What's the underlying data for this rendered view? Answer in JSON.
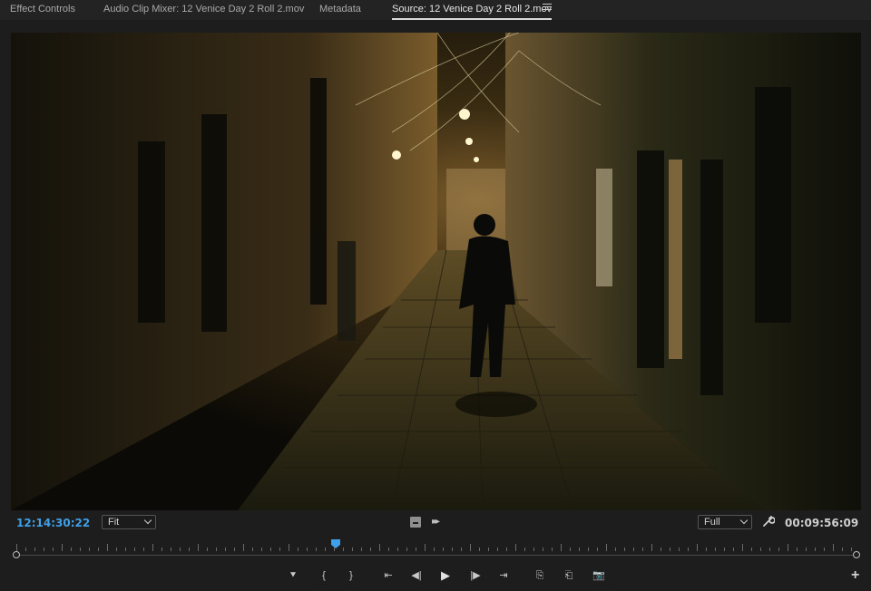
{
  "tabs": [
    {
      "label": "Effect Controls",
      "active": false
    },
    {
      "label": "Audio Clip Mixer: 12 Venice Day 2 Roll 2.mov",
      "active": false
    },
    {
      "label": "Metadata",
      "active": false
    },
    {
      "label": "Source: 12 Venice Day 2 Roll 2.mov",
      "active": true
    }
  ],
  "viewer": {
    "current_timecode": "12:14:30:22",
    "duration_timecode": "00:09:56:09",
    "zoom_select": "Fit",
    "resolution_select": "Full",
    "playhead_fraction": 0.38
  },
  "icons": {
    "panel_menu": "hamburger-menu-icon",
    "settings": "settings-icon",
    "wrench": "wrench-icon",
    "add": "plus-icon"
  },
  "transport": [
    {
      "name": "add-marker-button",
      "glyph": "⯆"
    },
    {
      "name": "mark-in-button",
      "glyph": "{"
    },
    {
      "name": "mark-out-button",
      "glyph": "}"
    },
    {
      "name": "go-to-in-button",
      "glyph": "⇤"
    },
    {
      "name": "step-back-button",
      "glyph": "◀|"
    },
    {
      "name": "play-button",
      "glyph": "▶"
    },
    {
      "name": "step-forward-button",
      "glyph": "|▶"
    },
    {
      "name": "go-to-out-button",
      "glyph": "⇥"
    },
    {
      "name": "insert-button",
      "glyph": "⎘"
    },
    {
      "name": "overwrite-button",
      "glyph": "⎗"
    },
    {
      "name": "export-frame-button",
      "glyph": "📷"
    }
  ],
  "colors": {
    "accent_blue": "#3f9fe8"
  }
}
